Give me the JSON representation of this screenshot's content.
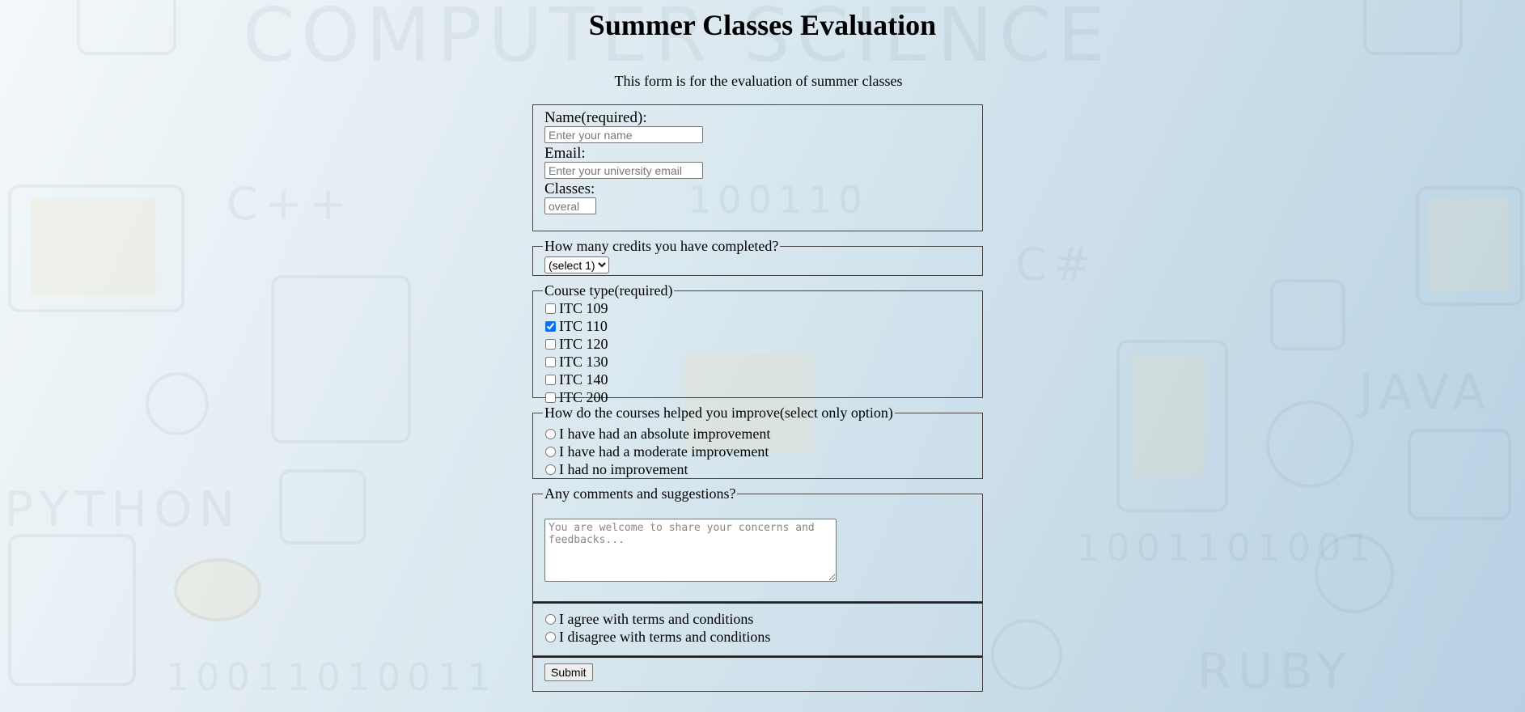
{
  "page": {
    "title": "Summer Classes Evaluation",
    "intro": "This form is for the evaluation of summer classes"
  },
  "background": {
    "words": [
      "COMPUTER SCIENCE",
      "C++",
      "C#",
      "JAVA",
      "PYTHON",
      "RUBY",
      "100110",
      "1001101001",
      "10011010011"
    ]
  },
  "form": {
    "name_label": "Name(required):",
    "name_placeholder": "Enter your name",
    "email_label": "Email:",
    "email_placeholder": "Enter your university email",
    "classes_label": "Classes:",
    "classes_placeholder": "overal",
    "credits_legend": "How many credits you have completed?",
    "credits_selected": "(select 1)",
    "course_legend": "Course type(required)",
    "courses": [
      {
        "label": "ITC 109",
        "checked": false
      },
      {
        "label": "ITC 110",
        "checked": true
      },
      {
        "label": "ITC 120",
        "checked": false
      },
      {
        "label": "ITC 130",
        "checked": false
      },
      {
        "label": "ITC 140",
        "checked": false
      },
      {
        "label": "ITC 200",
        "checked": false
      }
    ],
    "improve_legend": "How do the courses helped you improve(select only option)",
    "improve_options": [
      "I have had an absolute improvement",
      "I have had a moderate improvement",
      "I had no improvement"
    ],
    "comments_legend": "Any comments and suggestions?",
    "comments_placeholder": "You are welcome to share your concerns and feedbacks...",
    "terms_options": [
      "I agree with terms and conditions",
      "I disagree with terms and conditions"
    ],
    "submit_label": "Submit"
  }
}
